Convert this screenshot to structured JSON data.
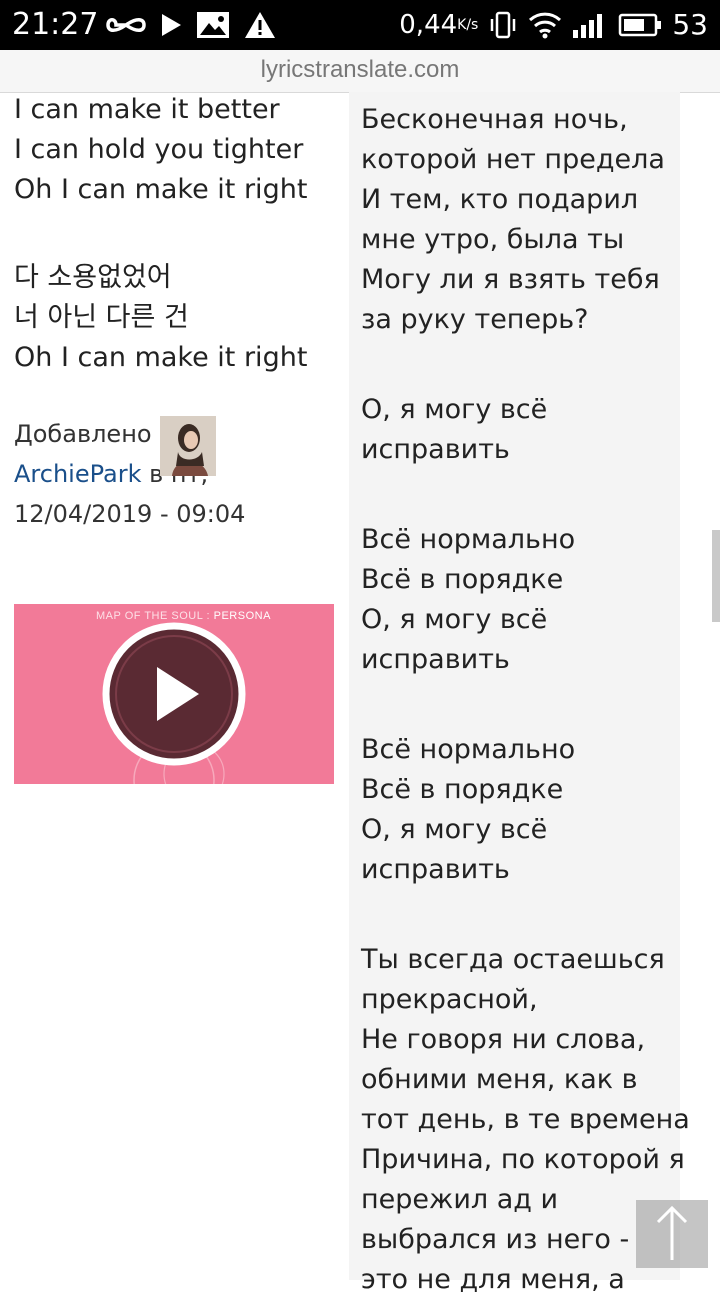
{
  "status_bar": {
    "time": "21:27",
    "speed": "0,44",
    "speed_unit": "K/s",
    "battery": "53",
    "icons": [
      "infinity-icon",
      "play-icon",
      "image-icon",
      "warning-icon",
      "vibrate-icon",
      "wifi-icon",
      "signal-icon",
      "battery-icon"
    ]
  },
  "url": "lyricstranslate.com",
  "left_lyrics": {
    "block1": [
      "I can make it better",
      "I can hold you tighter",
      "Oh I can make it right"
    ],
    "block2": [
      "다 소용없었어",
      "너 아닌 다른 건",
      "Oh I can make it right"
    ]
  },
  "added": {
    "label": "Добавлено",
    "user": "ArchiePark",
    "on": "в пт,",
    "datetime": "12/04/2019 - 09:04"
  },
  "video": {
    "title_part1": "MAP OF THE SOUL : ",
    "title_part2": "PERSONA",
    "play_icon": "play-circle-icon"
  },
  "right_lyrics": {
    "block1": [
      "Бесконечная ночь,",
      "которой нет предела",
      "И тем, кто подарил",
      "мне утро, была ты",
      "Могу ли я взять тебя",
      "за руку теперь?"
    ],
    "block2": [
      "О, я могу всё",
      "исправить"
    ],
    "block3": [
      "Всё нормально",
      "Всё в порядке",
      "О, я могу всё",
      "исправить"
    ],
    "block4": [
      "Всё нормально",
      "Всё в порядке",
      "О, я могу всё",
      "исправить"
    ],
    "block5": [
      "Ты всегда остаешься",
      "прекрасной,",
      "Не говоря ни слова,",
      "обними меня, как в",
      "тот день, в те времена",
      "Причина, по которой я",
      "пережил ад и",
      "выбрался из него -",
      "это не для меня, а"
    ]
  },
  "scroll_top_icon": "arrow-up-icon"
}
